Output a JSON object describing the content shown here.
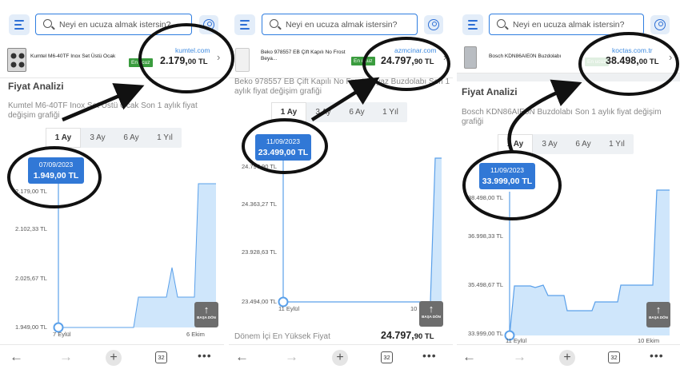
{
  "search": {
    "placeholder": "Neyi en ucuza almak istersin?"
  },
  "tabs": [
    "1 Ay",
    "3 Ay",
    "6 Ay",
    "1 Yıl"
  ],
  "back_to_top_label": "BAŞA DÖN",
  "open_tabs_count": "32",
  "colors": {
    "accent": "#3178d6",
    "chart_fill": "#cfe6fb",
    "chart_line": "#5aa0ea",
    "badge": "#3a9c3e"
  },
  "panels": [
    {
      "product": {
        "name": "Kumtel M6-40TF Inox Set Üstü Ocak",
        "badge": "En ucuz",
        "store": "kumtel.com",
        "price_main": "2.179,",
        "price_decimal": "00 TL"
      },
      "heading": "Fiyat Analizi",
      "subtitle": "Kumtel M6-40TF Inox Set Üstü Ocak Son 1 aylık fiyat değişim grafiği",
      "tooltip": {
        "date": "07/09/2023",
        "value": "1.949,00 TL"
      },
      "chart_data": {
        "type": "area",
        "y_labels": [
          "2.179,00 TL",
          "2.102,33 TL",
          "2.025,67 TL",
          "1.949,00 TL"
        ],
        "x_labels": [
          "7 Eylül",
          "6 Ekim"
        ],
        "ylim": [
          1949,
          2179
        ],
        "x": [
          0,
          0.48,
          0.52,
          0.67,
          0.69,
          0.72,
          0.75,
          0.8,
          0.84,
          0.88,
          0.92,
          0.94,
          1.0
        ],
        "y": [
          1949,
          1949,
          1949,
          1949,
          2025.67,
          2025.67,
          2025.67,
          2025.67,
          2025.67,
          2025.67,
          2090,
          2025.67,
          2025.67
        ]
      }
    },
    {
      "product": {
        "name": "Beko 978557 EB Çift Kapılı No Frost Beya...",
        "badge": "En ucuz",
        "store": "azmcinar.com",
        "price_main": "24.797,",
        "price_decimal": "90 TL"
      },
      "heading_partial": "Beko 978557 EB Çift Kapılı No Frost Beyaz Buzdolabı Son 1 aylık fiyat değişim grafiği",
      "tooltip": {
        "date": "11/09/2023",
        "value": "23.499,00 TL"
      },
      "footer": {
        "label": "Dönem İçi En Yüksek Fiyat",
        "price_main": "24.797,",
        "price_decimal": "90 TL"
      },
      "chart_data": {
        "type": "area",
        "y_labels": [
          "24.797,90 TL",
          "24.363,27 TL",
          "23.928,63 TL",
          "23.494,00 TL"
        ],
        "x_labels": [
          "11 Eylül",
          "10 Ekim"
        ],
        "ylim": [
          23494,
          24797.9
        ]
      }
    },
    {
      "product": {
        "name": "Bosch KDN86AIE0N Buzdolabı",
        "badge": "En ucuz",
        "store": "koctas.com.tr",
        "price_main": "38.498,",
        "price_decimal": "00 TL"
      },
      "heading": "Fiyat Analizi",
      "subtitle": "Bosch KDN86AIE0N Buzdolabı Son 1 aylık fiyat değişim grafiği",
      "tooltip": {
        "date": "11/09/2023",
        "value": "33.999,00 TL"
      },
      "chart_data": {
        "type": "area",
        "y_labels": [
          "38.498,00 TL",
          "36.998,33 TL",
          "35.498,67 TL",
          "33.999,00 TL"
        ],
        "x_labels": [
          "11 Eylül",
          "10 Ekim"
        ],
        "ylim": [
          33999,
          38498
        ]
      }
    }
  ]
}
